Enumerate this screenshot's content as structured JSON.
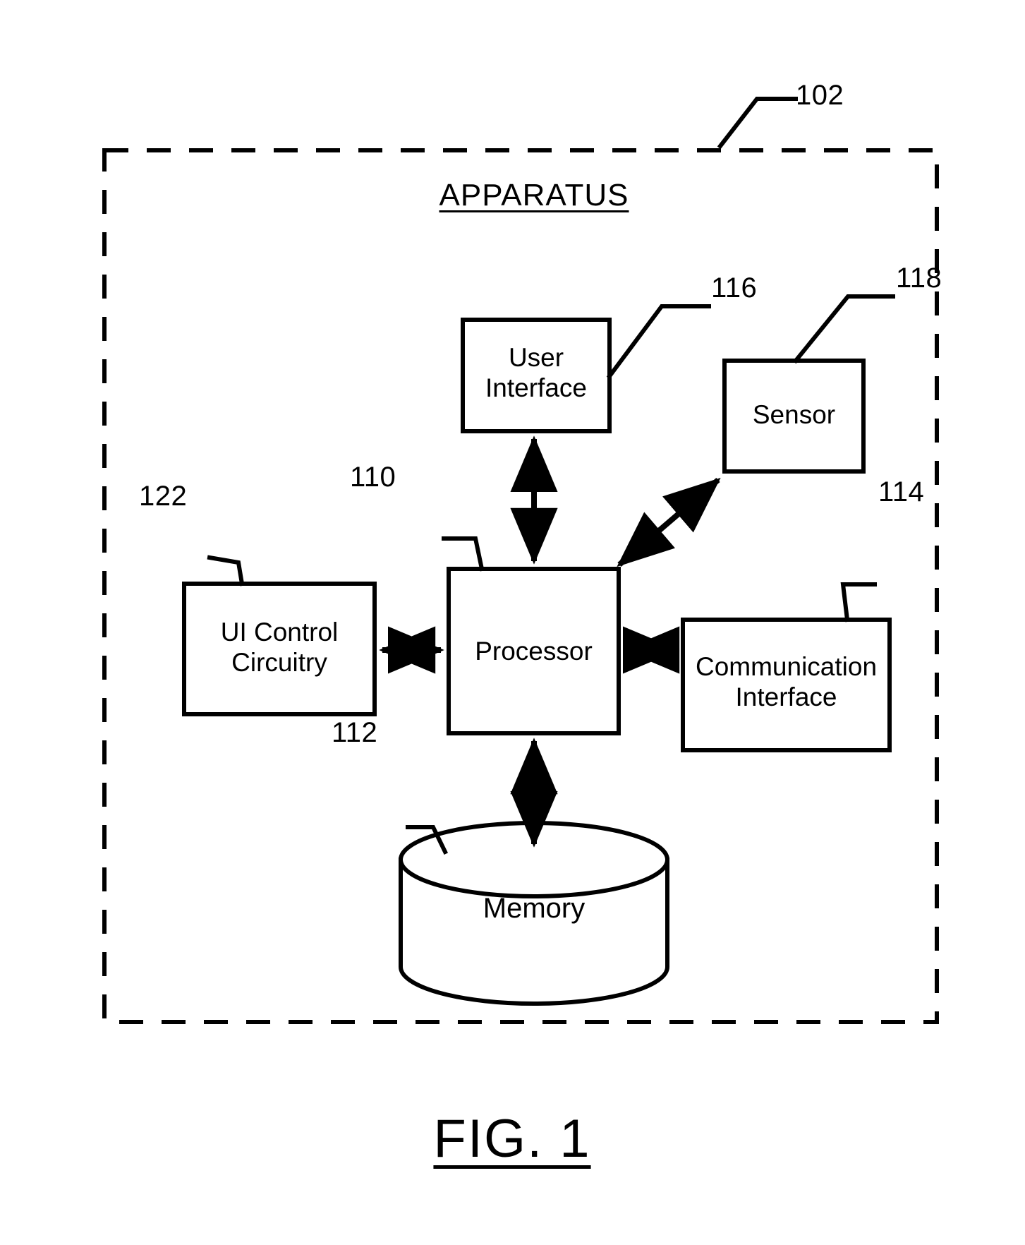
{
  "figure": {
    "caption": "FIG. 1",
    "title": "APPARATUS",
    "outer_ref": "102",
    "line_color": "#000000",
    "background_color": "#ffffff"
  },
  "blocks": [
    {
      "id": "user-interface",
      "label": "User\nInterface",
      "ref": "116",
      "shape": "rectangle"
    },
    {
      "id": "sensor",
      "label": "Sensor",
      "ref": "118",
      "shape": "rectangle"
    },
    {
      "id": "ui-control-circuitry",
      "label": "UI Control\nCircuitry",
      "ref": "122",
      "shape": "rectangle"
    },
    {
      "id": "processor",
      "label": "Processor",
      "ref": "110",
      "shape": "rectangle"
    },
    {
      "id": "communication-interface",
      "label": "Communication\nInterface",
      "ref": "114",
      "shape": "rectangle"
    },
    {
      "id": "memory",
      "label": "Memory",
      "ref": "112",
      "shape": "cylinder"
    }
  ],
  "connections": [
    {
      "from": "processor",
      "to": "user-interface",
      "arrow": "double"
    },
    {
      "from": "processor",
      "to": "sensor",
      "arrow": "double"
    },
    {
      "from": "ui-control-circuitry",
      "to": "processor",
      "arrow": "double"
    },
    {
      "from": "processor",
      "to": "communication-interface",
      "arrow": "double"
    },
    {
      "from": "processor",
      "to": "memory",
      "arrow": "double"
    }
  ],
  "labels": {
    "user_interface": "User\nInterface",
    "sensor": "Sensor",
    "ui_control_circuitry": "UI Control\nCircuitry",
    "processor": "Processor",
    "communication_interface": "Communication\nInterface",
    "memory": "Memory",
    "ref_102": "102",
    "ref_110": "110",
    "ref_112": "112",
    "ref_114": "114",
    "ref_116": "116",
    "ref_118": "118",
    "ref_122": "122"
  }
}
